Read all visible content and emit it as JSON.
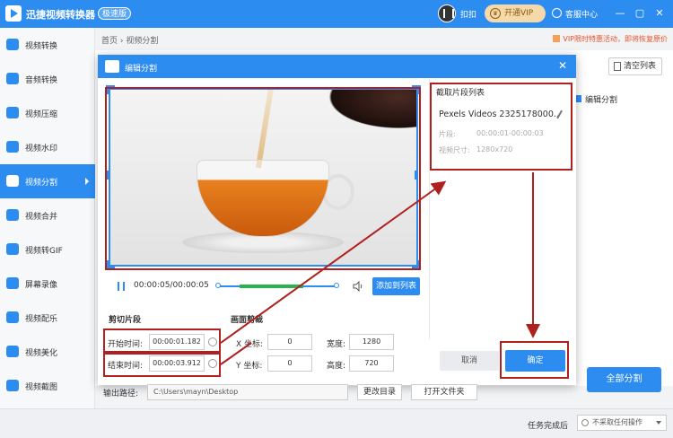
{
  "titlebar": {
    "app_title": "迅捷视频转换器",
    "edition": "极速版",
    "signin": "扣扣",
    "vip_button": "开通VIP",
    "service": "客服中心",
    "minimize": "—",
    "restore": "▢",
    "close": "✕"
  },
  "sidebar": {
    "items": [
      {
        "label": "视频转换"
      },
      {
        "label": "音频转换"
      },
      {
        "label": "视频压缩"
      },
      {
        "label": "视频水印"
      },
      {
        "label": "视频分割"
      },
      {
        "label": "视频合并"
      },
      {
        "label": "视频转GIF"
      },
      {
        "label": "屏幕录像"
      },
      {
        "label": "视频配乐"
      },
      {
        "label": "视频美化"
      },
      {
        "label": "视频截图"
      }
    ],
    "active_index": 4
  },
  "breadcrumb": {
    "home": "首页",
    "sep": "›",
    "current": "视频分割"
  },
  "promo": "VIP限时特惠活动，即将恢复原价",
  "main": {
    "clear_list": "清空列表",
    "bg_tag": "编辑分割",
    "split_all": "全部分割"
  },
  "dialog": {
    "title": "编辑分割",
    "close": "✕",
    "player": {
      "timecode": "00:00:05/00:00:05",
      "add_to_list": "添加到列表",
      "selection_start_fraction": 0.18,
      "selection_end_fraction": 0.72
    },
    "cut_section": {
      "title": "剪切片段",
      "start_label": "开始时间:",
      "start_value": "00:00:01.182",
      "end_label": "结束时间:",
      "end_value": "00:00:03.912"
    },
    "crop_section": {
      "title": "画面剪裁",
      "x_label": "X 坐标:",
      "x_value": "0",
      "y_label": "Y 坐标:",
      "y_value": "0",
      "width_label": "宽度:",
      "width_value": "1280",
      "height_label": "高度:",
      "height_value": "720"
    },
    "clip_list": {
      "title": "截取片段列表",
      "name": "Pexels Videos 2325178000..",
      "segment_label": "片段:",
      "segment_value": "00:00:01-00:00:03",
      "size_label": "视频尺寸:",
      "size_value": "1280x720"
    },
    "cancel": "取消",
    "confirm": "确定",
    "output": {
      "label": "输出路径:",
      "path": "C:\\Users\\mayn\\Desktop",
      "change_dir": "更改目录",
      "open_folder": "打开文件夹"
    }
  },
  "bottombar": {
    "task_label": "任务完成后",
    "task_option": "不采取任何操作"
  },
  "colors": {
    "accent": "#2d8cf0",
    "annotation": "#b0201f",
    "selection": "#29b34a"
  }
}
